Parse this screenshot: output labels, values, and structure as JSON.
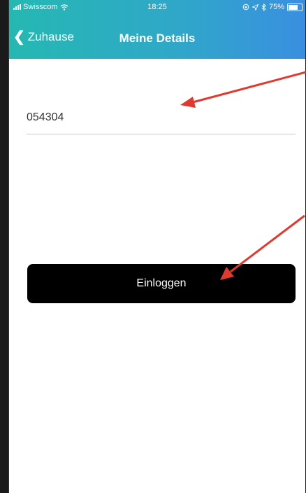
{
  "status_bar": {
    "carrier": "Swisscom",
    "time": "18:25",
    "battery": "75%"
  },
  "nav": {
    "back_label": "Zuhause",
    "title": "Meine Details"
  },
  "form": {
    "code_value": "054304",
    "login_label": "Einloggen"
  },
  "colors": {
    "header_start": "#25b8b2",
    "header_end": "#3a8fe0",
    "button": "#000000",
    "annotation_arrow": "#e03a2f"
  }
}
